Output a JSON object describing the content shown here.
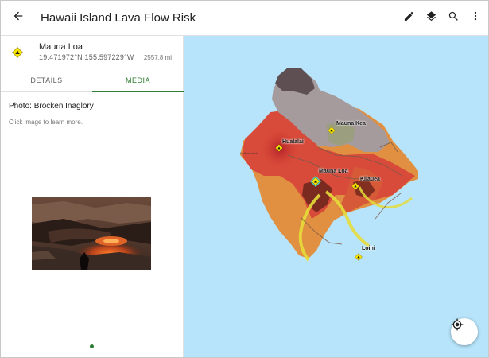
{
  "app": {
    "title": "Hawaii Island Lava Flow Risk",
    "icons": {
      "back": "arrow-back-icon",
      "edit": "pencil-icon",
      "layers": "layers-icon",
      "search": "search-icon",
      "more": "more-vert-icon"
    }
  },
  "feature": {
    "name": "Mauna Loa",
    "coordinates": "19.471972°N  155.597229°W",
    "distance": "2557.8 mi",
    "icon": "volcano-marker-icon"
  },
  "tabs": [
    {
      "label": "DETAILS",
      "active": false
    },
    {
      "label": "MEDIA",
      "active": true
    }
  ],
  "media": {
    "title": "Photo: Brocken Inaglory",
    "hint": "Click image to learn more.",
    "page_count": 1,
    "page_index": 0
  },
  "map": {
    "labels": {
      "mauna_kea": "Mauna Kea",
      "hualalai": "Hualalai",
      "mauna_loa": "Mauna Loa",
      "kilauea": "Kilauea",
      "loihi": "Loihi",
      "kailua": "Kailua Kona"
    },
    "colors": {
      "water": "#b7e4fa",
      "accent": "#2e7d32",
      "marker": "#f7e400"
    }
  }
}
